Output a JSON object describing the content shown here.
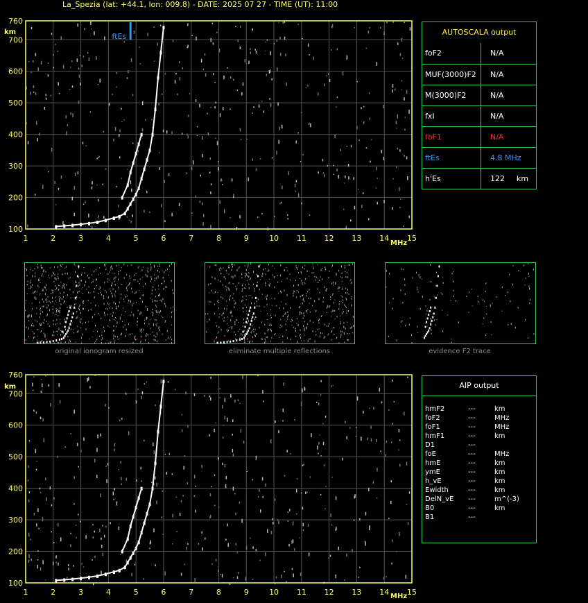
{
  "header": {
    "title": "La_Spezia (lat: +44.1, lon: 009.8) - DATE: 2025 07 27 - TIME (UT): 11:00"
  },
  "autoscala": {
    "title": "AUTOSCALA output",
    "rows": [
      {
        "key": "foF2",
        "value": "N/A",
        "unit": "",
        "color": "#ffffff"
      },
      {
        "key": "MUF(3000)F2",
        "value": "N/A",
        "unit": "",
        "color": "#ffffff"
      },
      {
        "key": "M(3000)F2",
        "value": "N/A",
        "unit": "",
        "color": "#ffffff"
      },
      {
        "key": "fxI",
        "value": "N/A",
        "unit": "",
        "color": "#ffffff"
      },
      {
        "key": "foF1",
        "value": "N/A",
        "unit": "",
        "color": "#ff2222"
      },
      {
        "key": "ftEs",
        "value": "4.8 MHz",
        "unit": "",
        "color": "#3399ff"
      },
      {
        "key": "h'Es",
        "value": "122",
        "unit": "km",
        "color": "#ffffff"
      }
    ]
  },
  "aip": {
    "title": "AIP output",
    "rows": [
      {
        "key": "hmF2",
        "dash": "---",
        "unit": "km"
      },
      {
        "key": "foF2",
        "dash": "---",
        "unit": "MHz"
      },
      {
        "key": "foF1",
        "dash": "---",
        "unit": "MHz"
      },
      {
        "key": "hmF1",
        "dash": "---",
        "unit": "km"
      },
      {
        "key": "D1",
        "dash": "---",
        "unit": ""
      },
      {
        "key": "foE",
        "dash": "---",
        "unit": "MHz"
      },
      {
        "key": "hmE",
        "dash": "---",
        "unit": "km"
      },
      {
        "key": "ymE",
        "dash": "---",
        "unit": "km"
      },
      {
        "key": "h_vE",
        "dash": "---",
        "unit": "km"
      },
      {
        "key": "Ewidth",
        "dash": "---",
        "unit": "km"
      },
      {
        "key": "DelN_vE",
        "dash": "---",
        "unit": "m^(-3)"
      },
      {
        "key": "B0",
        "dash": "---",
        "unit": "km"
      },
      {
        "key": "B1",
        "dash": "---",
        "unit": ""
      }
    ]
  },
  "thumbnails": [
    {
      "caption": "original ionogram resized"
    },
    {
      "caption": "eliminate multiple reflections"
    },
    {
      "caption": "evidence F2 trace"
    }
  ],
  "chart_data": [
    {
      "type": "scatter",
      "title": "",
      "xlabel": "MHz",
      "ylabel": "km",
      "xlim": [
        1,
        15
      ],
      "ylim": [
        100,
        760
      ],
      "x_ticks": [
        1,
        2,
        3,
        4,
        5,
        6,
        7,
        8,
        9,
        10,
        11,
        12,
        13,
        14,
        15
      ],
      "y_ticks": [
        100,
        200,
        300,
        400,
        500,
        600,
        700,
        760
      ],
      "grid": true,
      "marker": {
        "label": "ftEs",
        "x": 4.8,
        "color": "#3399ff"
      },
      "series": [
        {
          "points": [
            [
              2.1,
              108
            ],
            [
              2.4,
              110
            ],
            [
              2.7,
              112
            ],
            [
              3.0,
              115
            ],
            [
              3.3,
              118
            ],
            [
              3.6,
              122
            ],
            [
              3.9,
              128
            ],
            [
              4.2,
              135
            ],
            [
              4.4,
              140
            ],
            [
              4.6,
              150
            ],
            [
              4.7,
              165
            ],
            [
              4.8,
              180
            ],
            [
              4.9,
              195
            ],
            [
              5.0,
              210
            ],
            [
              5.1,
              230
            ],
            [
              5.2,
              260
            ],
            [
              5.3,
              290
            ],
            [
              5.4,
              320
            ],
            [
              5.5,
              350
            ],
            [
              5.6,
              400
            ],
            [
              5.7,
              480
            ],
            [
              5.8,
              580
            ],
            [
              5.9,
              660
            ],
            [
              6.0,
              740
            ]
          ]
        },
        {
          "points": [
            [
              4.5,
              200
            ],
            [
              4.7,
              240
            ],
            [
              4.8,
              280
            ],
            [
              4.9,
              310
            ],
            [
              5.0,
              340
            ],
            [
              5.1,
              370
            ],
            [
              5.2,
              400
            ]
          ]
        }
      ]
    },
    {
      "type": "scatter",
      "title": "",
      "xlabel": "MHz",
      "ylabel": "km",
      "xlim": [
        1,
        15
      ],
      "ylim": [
        100,
        760
      ],
      "x_ticks": [
        1,
        2,
        3,
        4,
        5,
        6,
        7,
        8,
        9,
        10,
        11,
        12,
        13,
        14,
        15
      ],
      "y_ticks": [
        100,
        200,
        300,
        400,
        500,
        600,
        700,
        760
      ],
      "grid": true,
      "series": [
        {
          "points": [
            [
              2.1,
              108
            ],
            [
              2.4,
              110
            ],
            [
              2.7,
              112
            ],
            [
              3.0,
              115
            ],
            [
              3.3,
              118
            ],
            [
              3.6,
              122
            ],
            [
              3.9,
              128
            ],
            [
              4.2,
              135
            ],
            [
              4.4,
              140
            ],
            [
              4.6,
              150
            ],
            [
              4.7,
              165
            ],
            [
              4.8,
              180
            ],
            [
              4.9,
              195
            ],
            [
              5.0,
              210
            ],
            [
              5.1,
              230
            ],
            [
              5.2,
              260
            ],
            [
              5.3,
              290
            ],
            [
              5.4,
              320
            ],
            [
              5.5,
              350
            ],
            [
              5.6,
              400
            ],
            [
              5.7,
              480
            ],
            [
              5.8,
              580
            ],
            [
              5.9,
              660
            ],
            [
              6.0,
              740
            ]
          ]
        },
        {
          "points": [
            [
              4.5,
              200
            ],
            [
              4.7,
              240
            ],
            [
              4.8,
              280
            ],
            [
              4.9,
              310
            ],
            [
              5.0,
              340
            ],
            [
              5.1,
              370
            ],
            [
              5.2,
              400
            ]
          ]
        }
      ]
    }
  ]
}
